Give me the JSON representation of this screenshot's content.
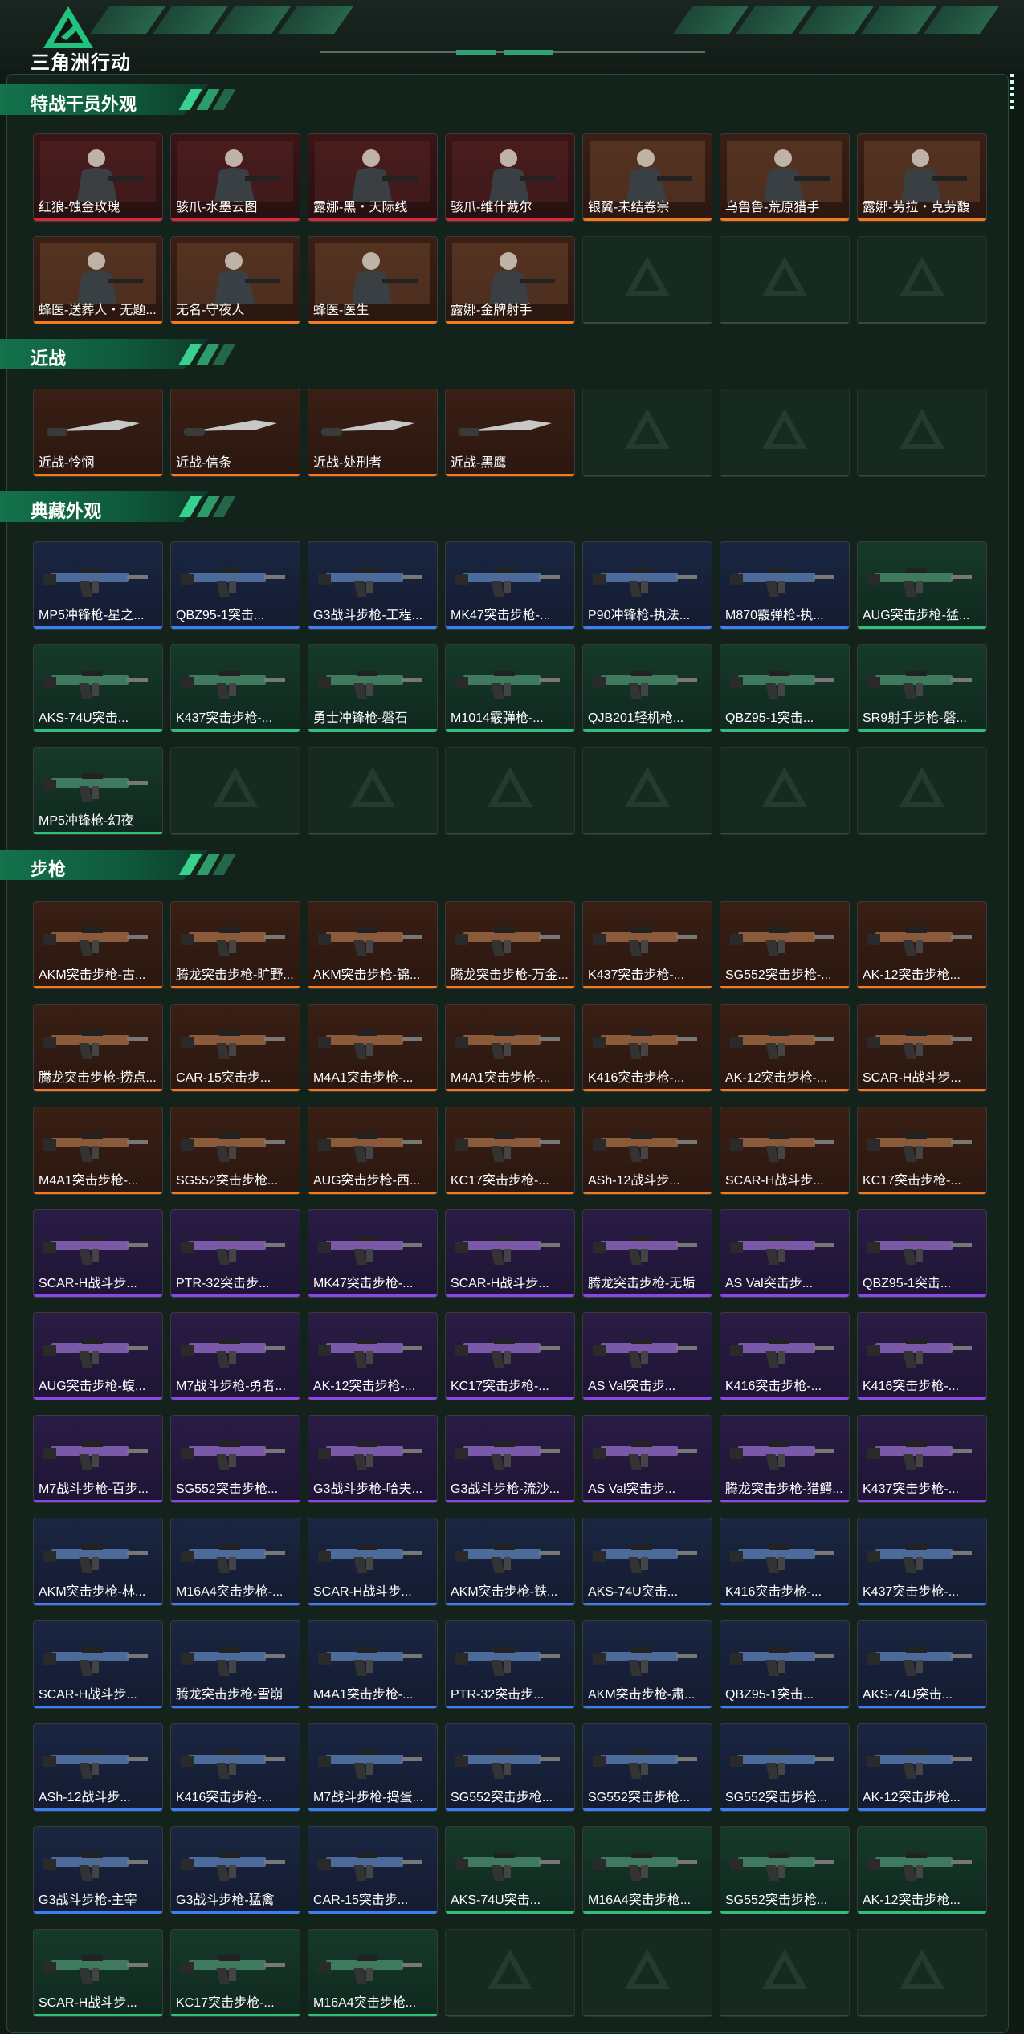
{
  "app": {
    "title": "三角洲行动"
  },
  "sections": [
    {
      "title": "特战干员外观",
      "items": [
        {
          "name": "红狼-蚀金玫瑰",
          "rarity": "red"
        },
        {
          "name": "骇爪-水墨云图",
          "rarity": "red"
        },
        {
          "name": "露娜-黑・天际线",
          "rarity": "red"
        },
        {
          "name": "骇爪-维什戴尔",
          "rarity": "red"
        },
        {
          "name": "银翼-未结卷宗",
          "rarity": "orange"
        },
        {
          "name": "乌鲁鲁-荒原猎手",
          "rarity": "orange"
        },
        {
          "name": "露娜-劳拉・克劳馥",
          "rarity": "orange"
        },
        {
          "name": "蜂医-送葬人・无题...",
          "rarity": "orange"
        },
        {
          "name": "无名-守夜人",
          "rarity": "orange"
        },
        {
          "name": "蜂医-医生",
          "rarity": "orange"
        },
        {
          "name": "露娜-金牌射手",
          "rarity": "orange"
        },
        {
          "empty": true
        },
        {
          "empty": true
        },
        {
          "empty": true
        }
      ]
    },
    {
      "title": "近战",
      "items": [
        {
          "name": "近战-怜悯",
          "rarity": "orange"
        },
        {
          "name": "近战-信条",
          "rarity": "orange"
        },
        {
          "name": "近战-处刑者",
          "rarity": "orange"
        },
        {
          "name": "近战-黑鹰",
          "rarity": "orange"
        },
        {
          "empty": true
        },
        {
          "empty": true
        },
        {
          "empty": true
        }
      ]
    },
    {
      "title": "典藏外观",
      "items": [
        {
          "name": "MP5冲锋枪-星之...",
          "rarity": "blue"
        },
        {
          "name": "QBZ95-1突击...",
          "rarity": "blue"
        },
        {
          "name": "G3战斗步枪-工程...",
          "rarity": "blue"
        },
        {
          "name": "MK47突击步枪-...",
          "rarity": "blue"
        },
        {
          "name": "P90冲锋枪-执法...",
          "rarity": "blue"
        },
        {
          "name": "M870霰弹枪-执...",
          "rarity": "blue"
        },
        {
          "name": "AUG突击步枪-猛...",
          "rarity": "green"
        },
        {
          "name": "AKS-74U突击...",
          "rarity": "green"
        },
        {
          "name": "K437突击步枪-...",
          "rarity": "green"
        },
        {
          "name": "勇士冲锋枪-磐石",
          "rarity": "green"
        },
        {
          "name": "M1014霰弹枪-...",
          "rarity": "green"
        },
        {
          "name": "QJB201轻机枪...",
          "rarity": "green"
        },
        {
          "name": "QBZ95-1突击...",
          "rarity": "green"
        },
        {
          "name": "SR9射手步枪-磐...",
          "rarity": "green"
        },
        {
          "name": "MP5冲锋枪-幻夜",
          "rarity": "green"
        },
        {
          "empty": true
        },
        {
          "empty": true
        },
        {
          "empty": true
        },
        {
          "empty": true
        },
        {
          "empty": true
        },
        {
          "empty": true
        }
      ]
    },
    {
      "title": "步枪",
      "items": [
        {
          "name": "AKM突击步枪-古...",
          "rarity": "orange"
        },
        {
          "name": "腾龙突击步枪-旷野...",
          "rarity": "orange"
        },
        {
          "name": "AKM突击步枪-锦...",
          "rarity": "orange"
        },
        {
          "name": "腾龙突击步枪-万金...",
          "rarity": "orange"
        },
        {
          "name": "K437突击步枪-...",
          "rarity": "orange"
        },
        {
          "name": "SG552突击步枪-...",
          "rarity": "orange"
        },
        {
          "name": "AK-12突击步枪...",
          "rarity": "orange"
        },
        {
          "name": "腾龙突击步枪-捞点...",
          "rarity": "orange"
        },
        {
          "name": "CAR-15突击步...",
          "rarity": "orange"
        },
        {
          "name": "M4A1突击步枪-...",
          "rarity": "orange"
        },
        {
          "name": "M4A1突击步枪-...",
          "rarity": "orange"
        },
        {
          "name": "K416突击步枪-...",
          "rarity": "orange"
        },
        {
          "name": "AK-12突击步枪-...",
          "rarity": "orange"
        },
        {
          "name": "SCAR-H战斗步...",
          "rarity": "orange"
        },
        {
          "name": "M4A1突击步枪-...",
          "rarity": "orange"
        },
        {
          "name": "SG552突击步枪...",
          "rarity": "orange"
        },
        {
          "name": "AUG突击步枪-西...",
          "rarity": "orange"
        },
        {
          "name": "KC17突击步枪-...",
          "rarity": "orange"
        },
        {
          "name": "ASh-12战斗步...",
          "rarity": "orange"
        },
        {
          "name": "SCAR-H战斗步...",
          "rarity": "orange"
        },
        {
          "name": "KC17突击步枪-...",
          "rarity": "orange"
        },
        {
          "name": "SCAR-H战斗步...",
          "rarity": "purple"
        },
        {
          "name": "PTR-32突击步...",
          "rarity": "purple"
        },
        {
          "name": "MK47突击步枪-...",
          "rarity": "purple"
        },
        {
          "name": "SCAR-H战斗步...",
          "rarity": "purple"
        },
        {
          "name": "腾龙突击步枪-无垢",
          "rarity": "purple"
        },
        {
          "name": "AS Val突击步...",
          "rarity": "purple"
        },
        {
          "name": "QBZ95-1突击...",
          "rarity": "purple"
        },
        {
          "name": "AUG突击步枪-蝮...",
          "rarity": "purple"
        },
        {
          "name": "M7战斗步枪-勇者...",
          "rarity": "purple"
        },
        {
          "name": "AK-12突击步枪-...",
          "rarity": "purple"
        },
        {
          "name": "KC17突击步枪-...",
          "rarity": "purple"
        },
        {
          "name": "AS Val突击步...",
          "rarity": "purple"
        },
        {
          "name": "K416突击步枪-...",
          "rarity": "purple"
        },
        {
          "name": "K416突击步枪-...",
          "rarity": "purple"
        },
        {
          "name": "M7战斗步枪-百步...",
          "rarity": "purple"
        },
        {
          "name": "SG552突击步枪...",
          "rarity": "purple"
        },
        {
          "name": "G3战斗步枪-哈夫...",
          "rarity": "purple"
        },
        {
          "name": "G3战斗步枪-流沙...",
          "rarity": "purple"
        },
        {
          "name": "AS Val突击步...",
          "rarity": "purple"
        },
        {
          "name": "腾龙突击步枪-猎鳄...",
          "rarity": "purple"
        },
        {
          "name": "K437突击步枪-...",
          "rarity": "purple"
        },
        {
          "name": "AKM突击步枪-林...",
          "rarity": "blue"
        },
        {
          "name": "M16A4突击步枪-...",
          "rarity": "blue"
        },
        {
          "name": "SCAR-H战斗步...",
          "rarity": "blue"
        },
        {
          "name": "AKM突击步枪-铁...",
          "rarity": "blue"
        },
        {
          "name": "AKS-74U突击...",
          "rarity": "blue"
        },
        {
          "name": "K416突击步枪-...",
          "rarity": "blue"
        },
        {
          "name": "K437突击步枪-...",
          "rarity": "blue"
        },
        {
          "name": "SCAR-H战斗步...",
          "rarity": "blue"
        },
        {
          "name": "腾龙突击步枪-雪崩",
          "rarity": "blue"
        },
        {
          "name": "M4A1突击步枪-...",
          "rarity": "blue"
        },
        {
          "name": "PTR-32突击步...",
          "rarity": "blue"
        },
        {
          "name": "AKM突击步枪-肃...",
          "rarity": "blue"
        },
        {
          "name": "QBZ95-1突击...",
          "rarity": "blue"
        },
        {
          "name": "AKS-74U突击...",
          "rarity": "blue"
        },
        {
          "name": "ASh-12战斗步...",
          "rarity": "blue"
        },
        {
          "name": "K416突击步枪-...",
          "rarity": "blue"
        },
        {
          "name": "M7战斗步枪-捣蛋...",
          "rarity": "blue"
        },
        {
          "name": "SG552突击步枪...",
          "rarity": "blue"
        },
        {
          "name": "SG552突击步枪...",
          "rarity": "blue"
        },
        {
          "name": "SG552突击步枪...",
          "rarity": "blue"
        },
        {
          "name": "AK-12突击步枪...",
          "rarity": "blue"
        },
        {
          "name": "G3战斗步枪-主宰",
          "rarity": "blue"
        },
        {
          "name": "G3战斗步枪-猛禽",
          "rarity": "blue"
        },
        {
          "name": "CAR-15突击步...",
          "rarity": "blue"
        },
        {
          "name": "AKS-74U突击...",
          "rarity": "green"
        },
        {
          "name": "M16A4突击步枪...",
          "rarity": "green"
        },
        {
          "name": "SG552突击步枪...",
          "rarity": "green"
        },
        {
          "name": "AK-12突击步枪...",
          "rarity": "green"
        },
        {
          "name": "SCAR-H战斗步...",
          "rarity": "green"
        },
        {
          "name": "KC17突击步枪-...",
          "rarity": "green"
        },
        {
          "name": "M16A4突击步枪...",
          "rarity": "green"
        },
        {
          "empty": true
        },
        {
          "empty": true
        },
        {
          "empty": true
        },
        {
          "empty": true
        }
      ]
    }
  ],
  "colors": {
    "accent": "#2dc07a",
    "orange": "#f47a1a",
    "red": "#d8283a",
    "blue": "#3c7ff2",
    "green": "#2dc07a",
    "purple": "#8a47e6"
  }
}
